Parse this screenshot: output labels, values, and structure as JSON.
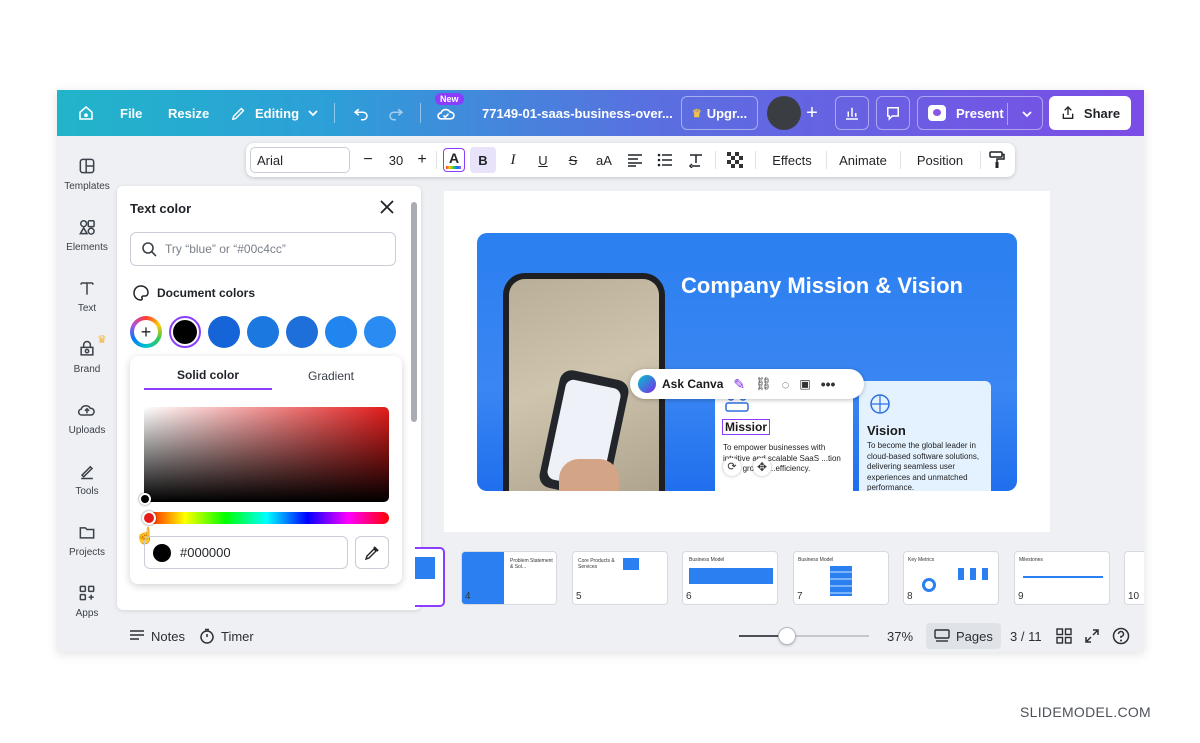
{
  "header": {
    "file_label": "File",
    "resize_label": "Resize",
    "editing_label": "Editing",
    "new_badge": "New",
    "doc_title": "77149-01-saas-business-over...",
    "upgrade_label": "Upgr...",
    "present_label": "Present",
    "share_label": "Share"
  },
  "sidebar": {
    "items": [
      {
        "label": "Templates",
        "icon": "templates-icon"
      },
      {
        "label": "Elements",
        "icon": "elements-icon"
      },
      {
        "label": "Text",
        "icon": "text-icon"
      },
      {
        "label": "Brand",
        "icon": "brand-icon"
      },
      {
        "label": "Uploads",
        "icon": "uploads-icon"
      },
      {
        "label": "Tools",
        "icon": "tools-icon"
      },
      {
        "label": "Projects",
        "icon": "projects-icon"
      },
      {
        "label": "Apps",
        "icon": "apps-icon"
      }
    ]
  },
  "toolbar": {
    "font": "Arial",
    "minus": "−",
    "size": "30",
    "plus": "+",
    "bold": "B",
    "italic": "I",
    "underline": "U",
    "strike": "S",
    "case": "aA",
    "effects": "Effects",
    "animate": "Animate",
    "position": "Position"
  },
  "color_panel": {
    "title": "Text color",
    "search_placeholder": "Try “blue” or “#00c4cc”",
    "doc_colors_label": "Document colors",
    "swatches": [
      "#000000",
      "#1565d8",
      "#1a78e0",
      "#1e6fd9",
      "#2185f0",
      "#2a8cf2"
    ],
    "tabs": [
      "Solid color",
      "Gradient"
    ],
    "hex_value": "#000000"
  },
  "slide": {
    "title": "Company Mission & Vision",
    "ask_canva": "Ask Canva",
    "mission_heading": "Missior",
    "mission_text": "To empower businesses with intuitive and scalable SaaS ...tion drive growth ...efficiency.",
    "vision_heading": "Vision",
    "vision_text": "To become the global leader in cloud-based software solutions, delivering seamless user experiences and unmatched performance."
  },
  "pages": {
    "thumbs": [
      {
        "num": "4",
        "title": "Problem Statement & Sol..."
      },
      {
        "num": "5",
        "title": "Core Products & Services"
      },
      {
        "num": "6",
        "title": "Business Model"
      },
      {
        "num": "7",
        "title": "Business Model"
      },
      {
        "num": "8",
        "title": "Key Metrics"
      },
      {
        "num": "9",
        "title": "Milestones"
      },
      {
        "num": "10",
        "title": ""
      }
    ]
  },
  "bottom": {
    "notes": "Notes",
    "timer": "Timer",
    "zoom": "37%",
    "zoom_fraction": 0.37,
    "pages_label": "Pages",
    "page_counter": "3 / 11"
  },
  "watermark": "SLIDEMODEL.COM"
}
